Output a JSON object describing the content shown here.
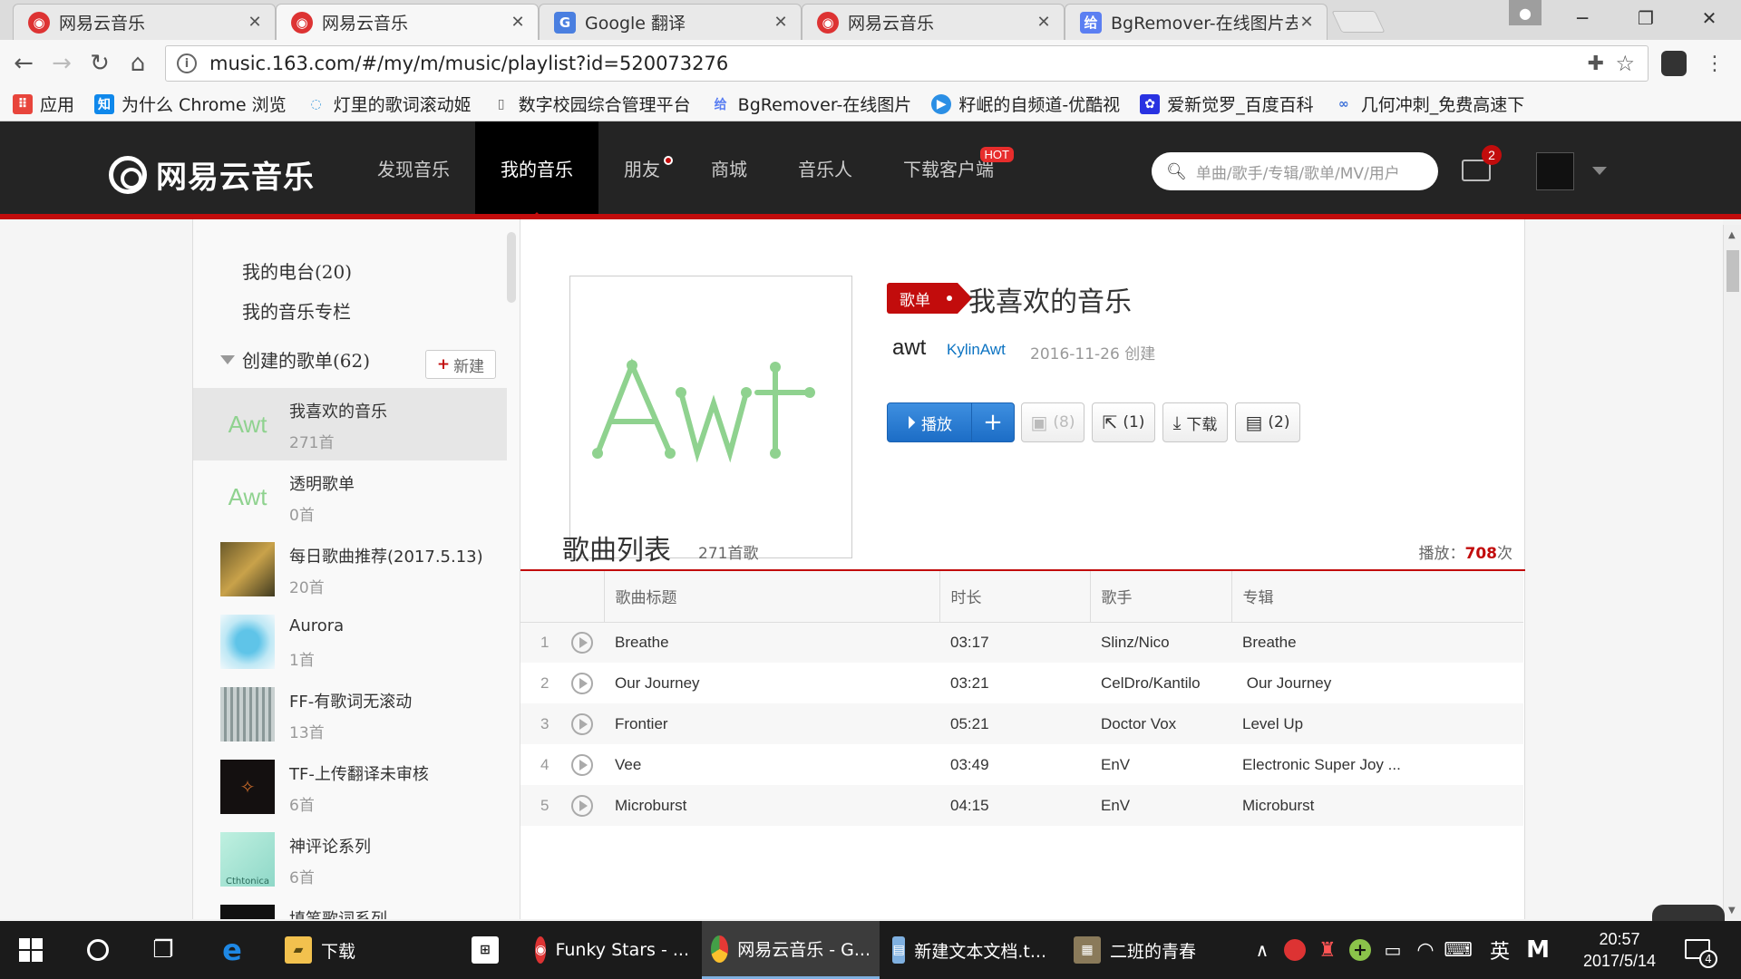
{
  "browser": {
    "tabs": [
      {
        "title": "网易云音乐",
        "icon": "netease-icon"
      },
      {
        "title": "网易云音乐",
        "icon": "netease-icon"
      },
      {
        "title": "Google 翻译",
        "icon": "google-translate-icon"
      },
      {
        "title": "网易云音乐",
        "icon": "netease-icon"
      },
      {
        "title": "BgRemover-在线图片去",
        "icon": "bgremover-icon"
      }
    ],
    "active_tab": 1,
    "url": "music.163.com/#/my/m/music/playlist?id=520073276",
    "bookmarks": [
      {
        "label": "应用",
        "icon": "apps-grid-icon",
        "color": "#e8453c"
      },
      {
        "label": "为什么 Chrome 浏览",
        "icon": "zhihu-icon",
        "color": "#0f88eb"
      },
      {
        "label": "灯里的歌词滚动姬",
        "icon": "spinner-icon",
        "color": "#4aa3df"
      },
      {
        "label": "数字校园综合管理平台",
        "icon": "page-icon",
        "color": "#888888"
      },
      {
        "label": "BgRemover-在线图片",
        "icon": "bgremover-icon",
        "color": "#5b7ff2"
      },
      {
        "label": "籽岷的自频道-优酷视",
        "icon": "youku-icon",
        "color": "#2b8fe5"
      },
      {
        "label": "爱新觉罗_百度百科",
        "icon": "baidu-paw-icon",
        "color": "#2932e1"
      },
      {
        "label": "几何冲刺_免费高速下",
        "icon": "link-icon",
        "color": "#3a6fd8"
      }
    ]
  },
  "site": {
    "logo_text": "网易云音乐",
    "nav": [
      {
        "label": "发现音乐",
        "active": false
      },
      {
        "label": "我的音乐",
        "active": true
      },
      {
        "label": "朋友",
        "active": false,
        "dot": true
      },
      {
        "label": "商城",
        "active": false
      },
      {
        "label": "音乐人",
        "active": false
      },
      {
        "label": "下载客户端",
        "active": false,
        "hot": "HOT"
      }
    ],
    "search_placeholder": "单曲/歌手/专辑/歌单/MV/用户",
    "mail_badge": "2",
    "accent": "#c20c0c"
  },
  "sidebar": {
    "radio": "我的电台(20)",
    "column": "我的音乐专栏",
    "created_header": "创建的歌单(62)",
    "new_button": "新建",
    "playlists": [
      {
        "name": "我喜欢的音乐",
        "count": "271首",
        "selected": true,
        "cover": "Awt"
      },
      {
        "name": "透明歌单",
        "count": "0首",
        "selected": false,
        "cover": "Awt"
      },
      {
        "name": "每日歌曲推荐(2017.5.13)",
        "count": "20首",
        "selected": false,
        "cover": ""
      },
      {
        "name": "Aurora",
        "count": "1首",
        "selected": false,
        "cover": ""
      },
      {
        "name": "FF-有歌词无滚动",
        "count": "13首",
        "selected": false,
        "cover": ""
      },
      {
        "name": "TF-上传翻译未审核",
        "count": "6首",
        "selected": false,
        "cover": ""
      },
      {
        "name": "神评论系列",
        "count": "6首",
        "selected": false,
        "cover": "Cthtonica"
      },
      {
        "name": "填笔歌词系列",
        "count": "",
        "selected": false,
        "cover": ""
      }
    ]
  },
  "playlist": {
    "cover_text": "Awt",
    "tag": "歌单",
    "title": "我喜欢的音乐",
    "creator_avatar": "awt",
    "creator": "KylinAwt",
    "created": "2016-11-26 创建",
    "buttons": {
      "play": "播放",
      "add": "+",
      "collect": "(8)",
      "share": "(1)",
      "download": "下载",
      "comment": "(2)"
    },
    "list_title": "歌曲列表",
    "list_count": "271首歌",
    "plays_label": "播放：",
    "plays_value": "708",
    "plays_unit": "次",
    "columns": [
      "",
      "",
      "歌曲标题",
      "时长",
      "歌手",
      "专辑"
    ],
    "songs": [
      {
        "idx": "1",
        "title": "Breathe",
        "duration": "03:17",
        "artist": "Slinz/Nico",
        "album": "Breathe"
      },
      {
        "idx": "2",
        "title": "Our Journey",
        "duration": "03:21",
        "artist": "CelDro/Kantilo",
        "album": " Our Journey"
      },
      {
        "idx": "3",
        "title": "Frontier",
        "duration": "05:21",
        "artist": "Doctor Vox",
        "album": "Level Up"
      },
      {
        "idx": "4",
        "title": "Vee",
        "duration": "03:49",
        "artist": "EnV",
        "album": "Electronic Super Joy ..."
      },
      {
        "idx": "5",
        "title": "Microburst",
        "duration": "04:15",
        "artist": "EnV",
        "album": "Microburst"
      }
    ]
  },
  "taskbar": {
    "apps": [
      {
        "label": "下载",
        "icon": "folder-icon",
        "color": "#f2c14e",
        "active": false
      },
      {
        "label": "",
        "icon": "store-icon",
        "color": "#ffffff",
        "active": false
      },
      {
        "label": "Funky Stars - ...",
        "icon": "netease-icon",
        "color": "#d33",
        "active": false
      },
      {
        "label": "网易云音乐 - G...",
        "icon": "chrome-icon",
        "color": "#4caf50",
        "active": true
      },
      {
        "label": "新建文本文档.t...",
        "icon": "notepad-icon",
        "color": "#7fb0e0",
        "active": false
      },
      {
        "label": "二班的青春",
        "icon": "image-icon",
        "color": "#8a7a5a",
        "active": false
      }
    ],
    "ime": "英",
    "time": "20:57",
    "date": "2017/5/14",
    "notifications": "4"
  }
}
